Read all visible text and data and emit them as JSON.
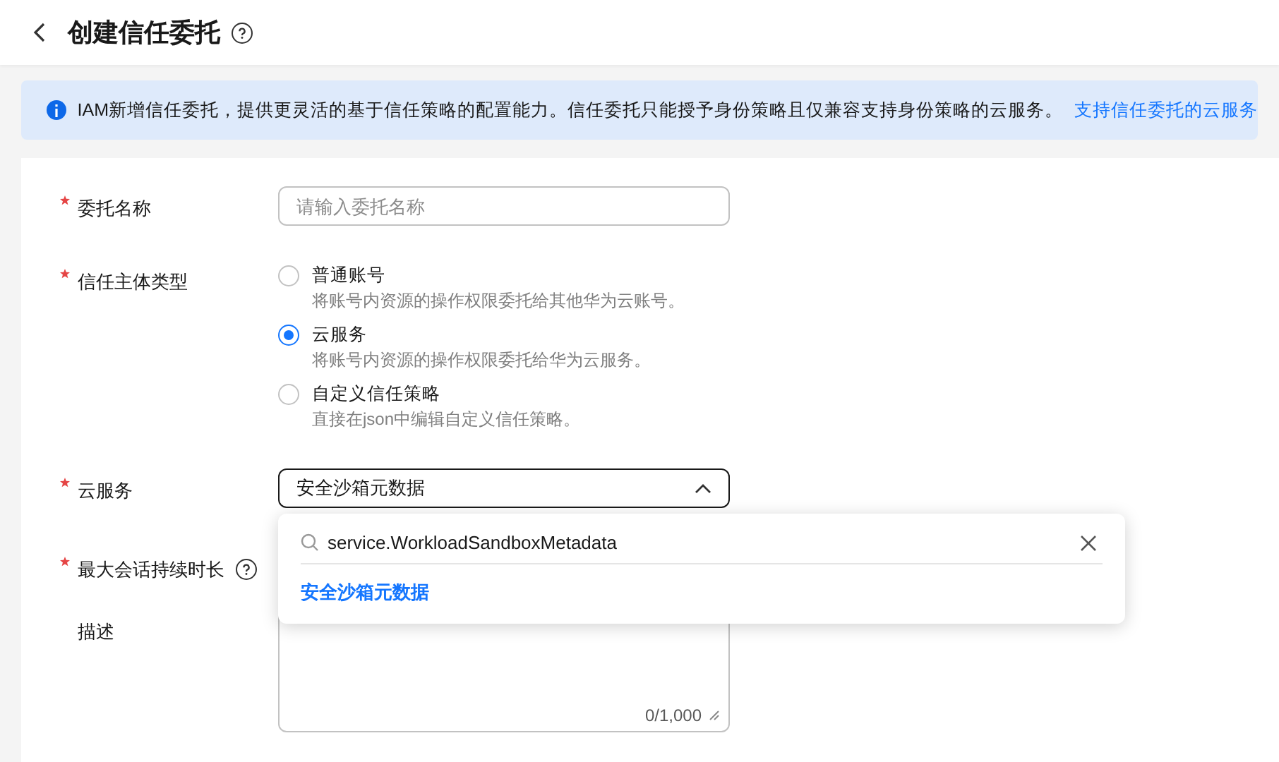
{
  "header": {
    "title": "创建信任委托"
  },
  "notice": {
    "text": "IAM新增信任委托，提供更灵活的基于信任策略的配置能力。信任委托只能授予身份策略且仅兼容支持身份策略的云服务。",
    "link": "支持信任委托的云服务"
  },
  "fields": [
    {
      "kind": "input",
      "label": "委托名称",
      "required": true,
      "placeholder": "请输入委托名称"
    },
    {
      "kind": "radio",
      "label": "信任主体类型",
      "required": true,
      "options": [
        {
          "label": "普通账号",
          "description": "将账号内资源的操作权限委托给其他华为云账号。",
          "selected": false
        },
        {
          "label": "云服务",
          "description": "将账号内资源的操作权限委托给华为云服务。",
          "selected": true
        },
        {
          "label": "自定义信任策略",
          "description": "直接在json中编辑自定义信任策略。",
          "selected": false
        }
      ]
    },
    {
      "kind": "select",
      "label": "云服务",
      "required": true,
      "value": "安全沙箱元数据",
      "expanded": true,
      "search": "service.WorkloadSandboxMetadata",
      "results": [
        "安全沙箱元数据"
      ]
    },
    {
      "kind": "hidden",
      "label": "最大会话持续时长",
      "required": true,
      "help": true
    },
    {
      "kind": "textarea",
      "label": "描述",
      "required": false,
      "counter": "0/1,000"
    }
  ]
}
